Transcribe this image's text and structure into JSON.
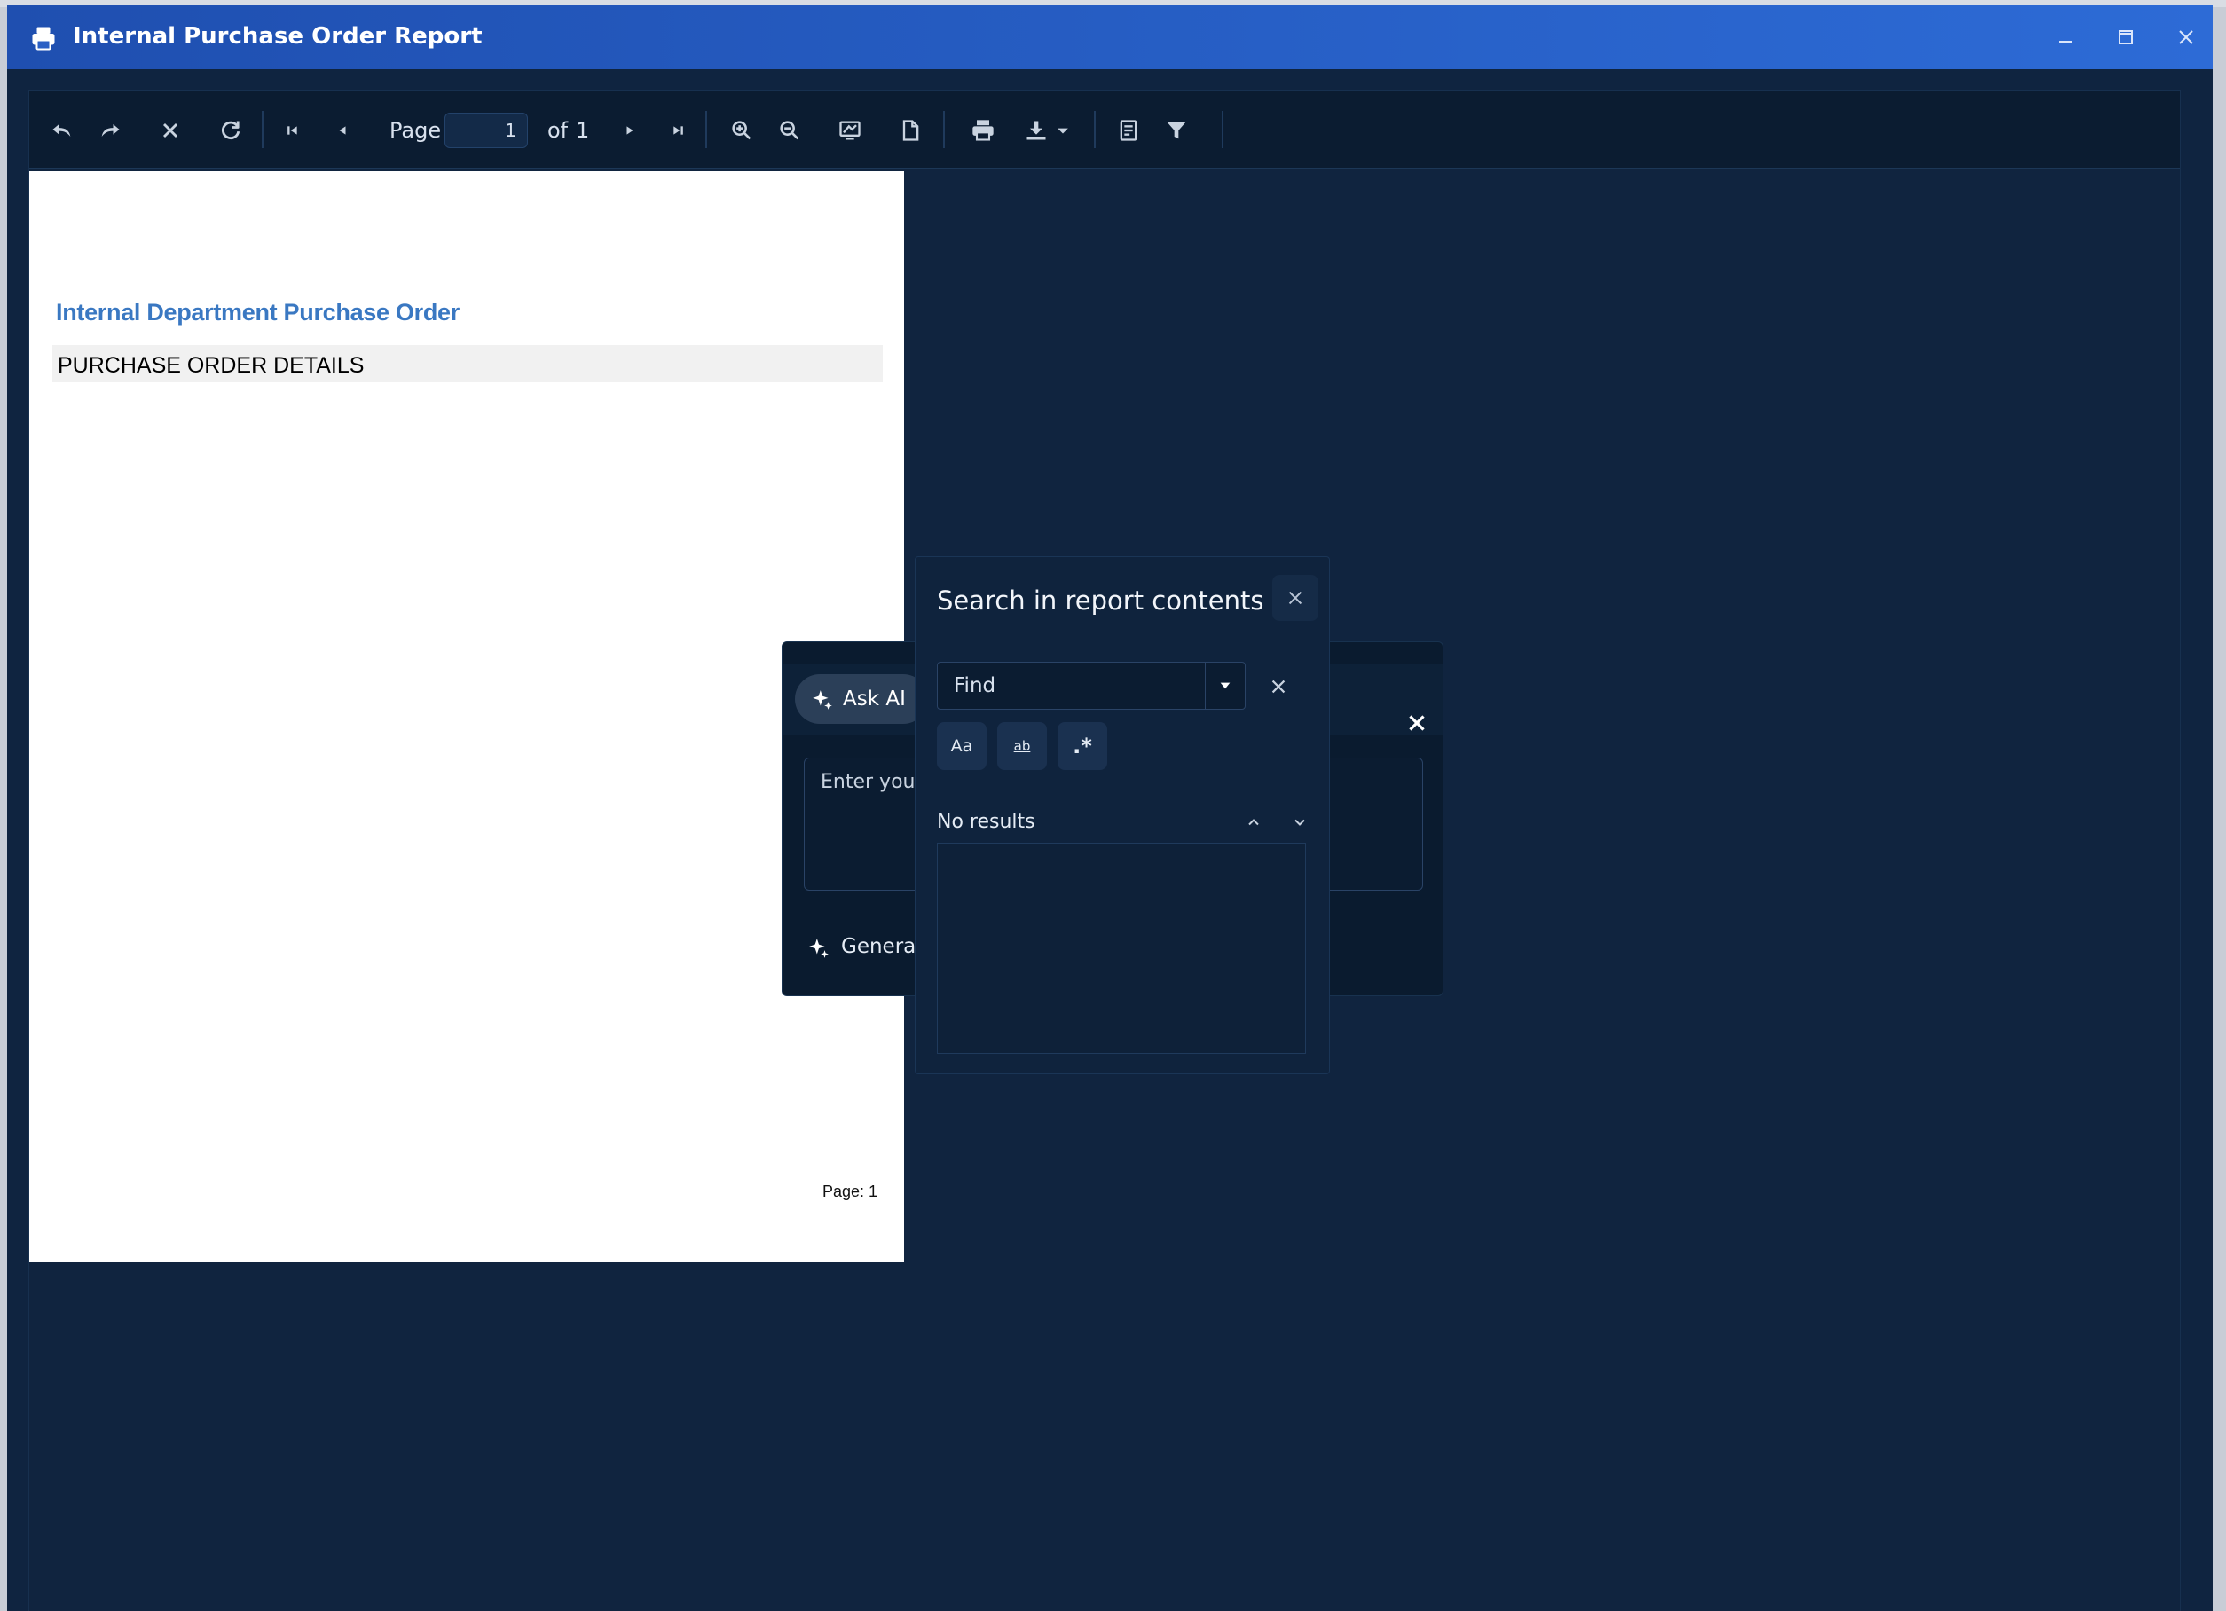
{
  "window": {
    "title": "Internal Purchase Order Report"
  },
  "toolbar": {
    "page_label": "Page",
    "page_current": "1",
    "page_of": "of",
    "page_total": "1"
  },
  "report": {
    "heading": "Internal Department Purchase Order",
    "section_title": "PURCHASE ORDER DETAILS",
    "footer_page": "Page: 1"
  },
  "ai_panel": {
    "ask_ai_label": "Ask AI",
    "prompt_placeholder": "Enter your",
    "generate_label": "Generat"
  },
  "search_panel": {
    "title": "Search in report contents",
    "find_value": "Find",
    "option_match_case": "Aa",
    "option_whole_word": "ab",
    "option_regex": ".*",
    "results_text": "No results"
  },
  "colors": {
    "titlebar": "#2d6bd6",
    "viewer_bg": "#10243f",
    "toolbar_bg": "#0b1c31",
    "report_heading": "#3a78c2"
  }
}
